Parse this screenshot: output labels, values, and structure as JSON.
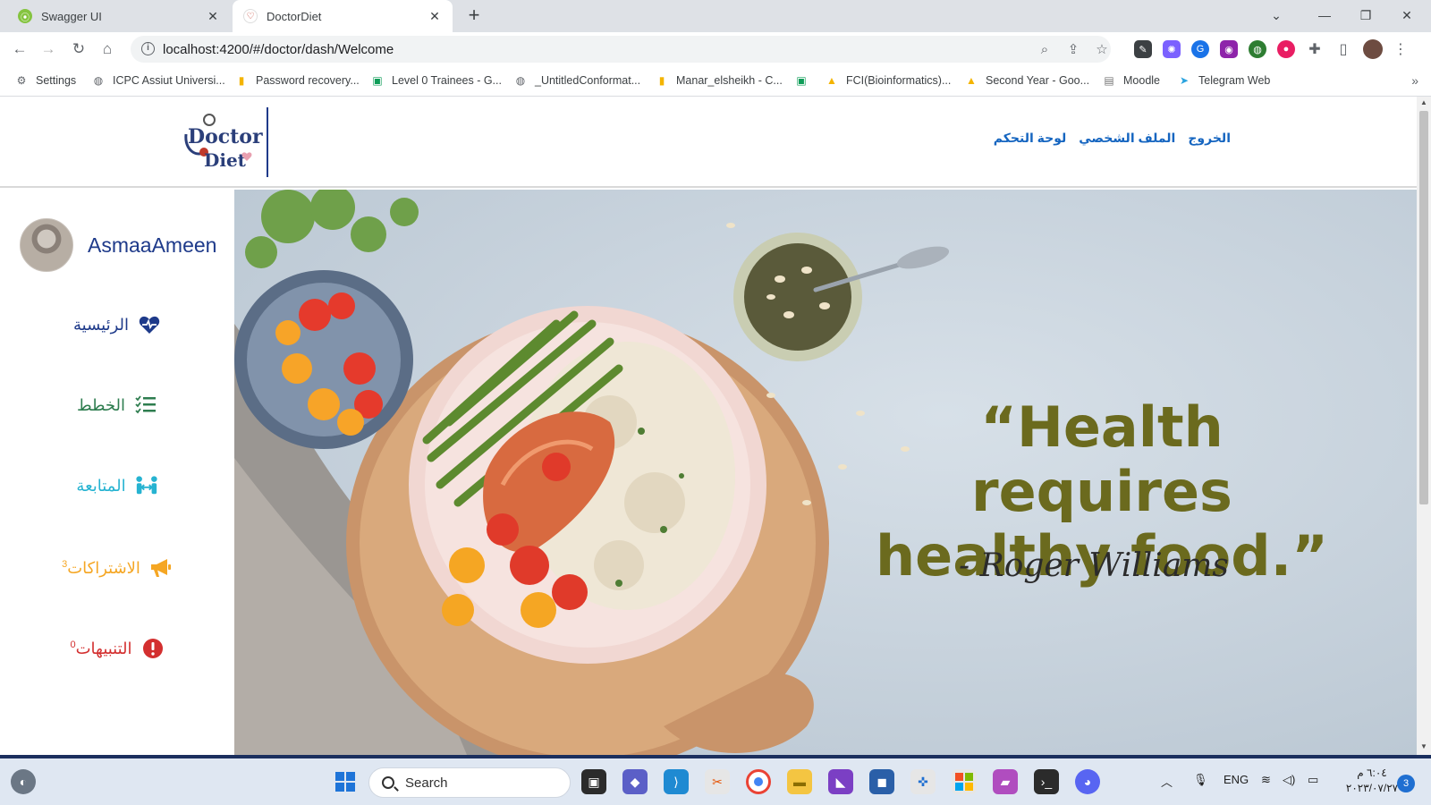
{
  "browser": {
    "tabs": [
      {
        "title": "Swagger UI",
        "active": false
      },
      {
        "title": "DoctorDiet",
        "active": true
      }
    ],
    "url": "localhost:4200/#/doctor/dash/Welcome",
    "bookmarks": [
      {
        "label": "Settings",
        "icon": "gear-icon"
      },
      {
        "label": "ICPC Assiut Universi...",
        "icon": "globe-icon"
      },
      {
        "label": "Password recovery...",
        "icon": "bar-chart-icon"
      },
      {
        "label": "Level 0 Trainees - G...",
        "icon": "sheets-icon"
      },
      {
        "label": "_UntitledConformat...",
        "icon": "globe-icon"
      },
      {
        "label": "Manar_elsheikh - C...",
        "icon": "bar-chart-icon"
      },
      {
        "label": "",
        "icon": "sheets-icon"
      },
      {
        "label": "FCI(Bioinformatics)...",
        "icon": "drive-icon"
      },
      {
        "label": "Second Year - Goo...",
        "icon": "drive-icon"
      },
      {
        "label": "Moodle",
        "icon": "moodle-icon"
      },
      {
        "label": "Telegram Web",
        "icon": "telegram-icon"
      }
    ]
  },
  "app": {
    "logo": {
      "line1": "Doctor",
      "line2": "Diet"
    },
    "nav": {
      "dashboard": "لوحة التحكم",
      "profile": "الملف الشخصي",
      "logout": "الخروج"
    },
    "user": {
      "name": "AsmaaAmeen"
    },
    "sidebar": [
      {
        "label": "الرئيسية",
        "icon": "heartbeat-icon",
        "color": "#1e3a8a",
        "badge": ""
      },
      {
        "label": "الخطط",
        "icon": "list-check-icon",
        "color": "#2e7d4f",
        "badge": ""
      },
      {
        "label": "المتابعة",
        "icon": "people-arrows-icon",
        "color": "#26b3d1",
        "badge": ""
      },
      {
        "label": "الاشتراكات",
        "icon": "megaphone-icon",
        "color": "#f5a623",
        "badge": "3"
      },
      {
        "label": "التنبيهات",
        "icon": "alert-circle-icon",
        "color": "#d32f2f",
        "badge": "0"
      }
    ],
    "hero": {
      "quote_line1": "“Health requires",
      "quote_line2": "healthy food.”",
      "author": "- Roger Williams"
    }
  },
  "taskbar": {
    "search_placeholder": "Search",
    "language": "ENG",
    "time": "٦:٠٤ م",
    "date": "٢٠٢٣/٠٧/٢٧",
    "notifications": "3"
  }
}
